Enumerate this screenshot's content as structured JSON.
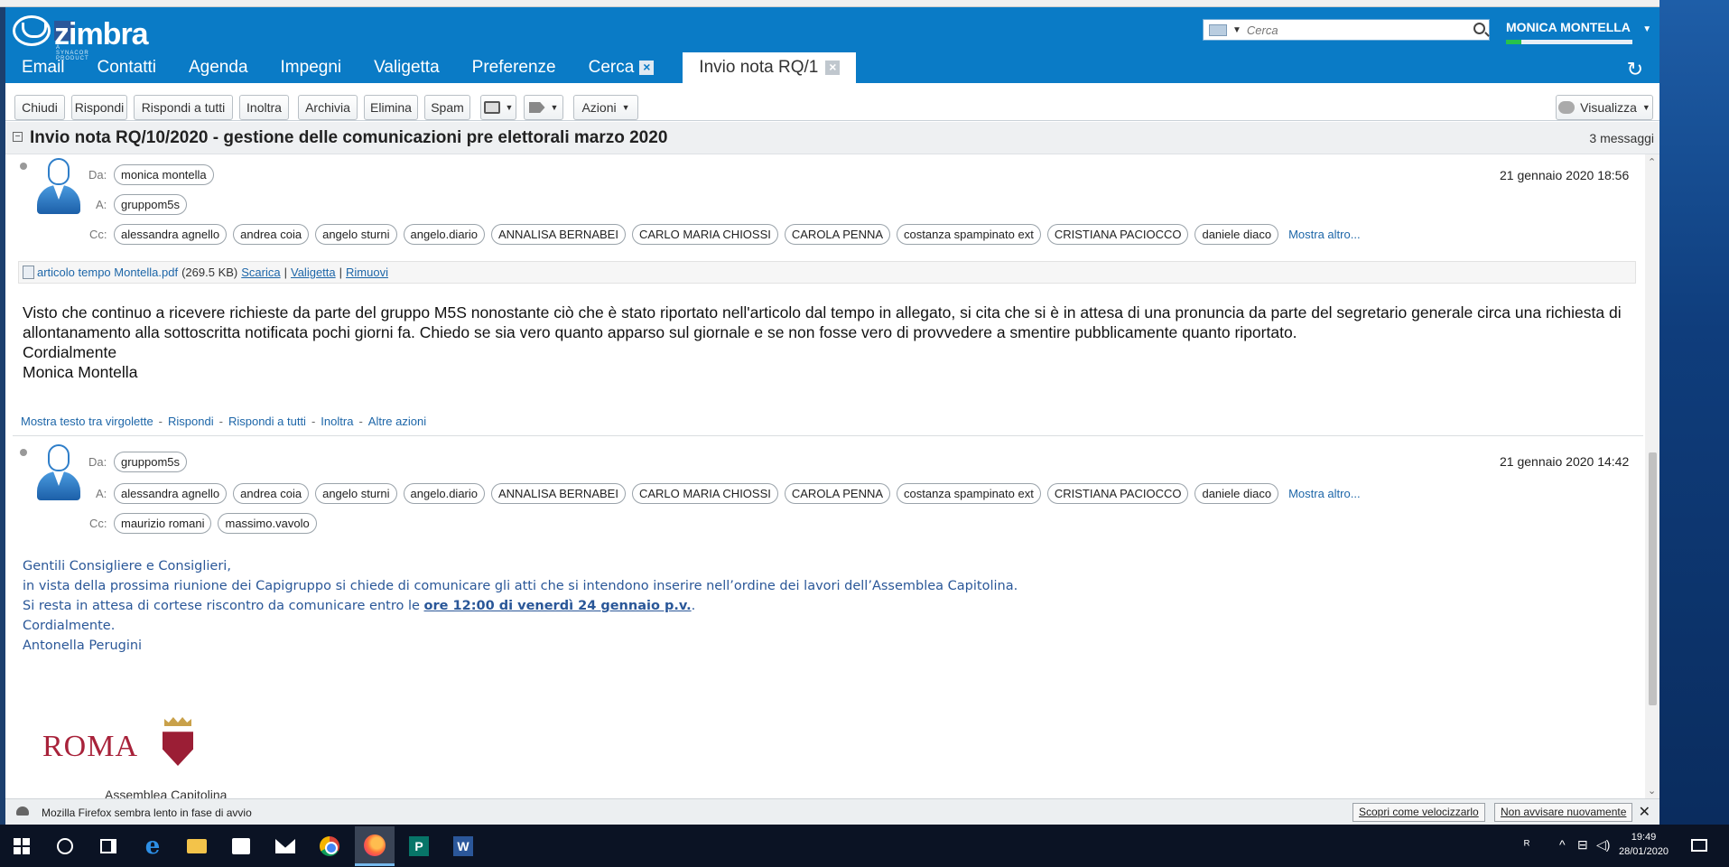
{
  "colors": {
    "brand": "#0a7bc6",
    "link": "#1d66a8",
    "body2_text": "#2a5798",
    "roma_red": "#a8223a"
  },
  "header": {
    "logo_text": "zimbra",
    "logo_sub": "A SYNACOR PRODUCT",
    "search_placeholder": "Cerca",
    "user_name": "MONICA MONTELLA",
    "quota_fraction": 0.12
  },
  "tabs": [
    {
      "label": "Email"
    },
    {
      "label": "Contatti"
    },
    {
      "label": "Agenda"
    },
    {
      "label": "Impegni"
    },
    {
      "label": "Valigetta"
    },
    {
      "label": "Preferenze"
    },
    {
      "label": "Cerca"
    },
    {
      "label": "Invio nota RQ/1"
    }
  ],
  "toolbar": {
    "close": "Chiudi",
    "reply": "Rispondi",
    "reply_all": "Rispondi a tutti",
    "forward": "Inoltra",
    "archive": "Archivia",
    "delete": "Elimina",
    "spam": "Spam",
    "actions": "Azioni",
    "view": "Visualizza"
  },
  "conversation": {
    "toggle": "−",
    "title": "Invio nota RQ/10/2020 - gestione delle comunicazioni pre elettorali marzo 2020",
    "count": "3 messaggi"
  },
  "labels": {
    "from": "Da:",
    "to": "A:",
    "cc": "Cc:"
  },
  "message1": {
    "from": "monica montella",
    "to": [
      "gruppom5s"
    ],
    "cc": [
      "alessandra agnello",
      "andrea coia",
      "angelo sturni",
      "angelo.diario",
      "ANNALISA BERNABEI",
      "CARLO MARIA CHIOSSI",
      "CAROLA PENNA",
      "costanza spampinato ext",
      "CRISTIANA PACIOCCO",
      "daniele diaco"
    ],
    "more": "Mostra altro...",
    "date": "21 gennaio 2020 18:56",
    "attachment": {
      "name": "articolo tempo Montella.pdf",
      "size": "(269.5 KB)",
      "download": "Scarica",
      "briefcase": "Valigetta",
      "remove": "Rimuovi"
    },
    "body": [
      "Visto che continuo a ricevere richieste da parte del gruppo M5S nonostante ciò che è stato riportato nell'articolo dal tempo in allegato,  si cita che si è in attesa di una pronuncia da parte del segretario generale circa una richiesta di allontanamento alla sottoscritta notificata pochi giorni fa. Chiedo se sia vero quanto apparso sul giornale e se non fosse vero di provvedere a smentire pubblicamente quanto riportato.",
      "Cordialmente",
      "Monica Montella"
    ],
    "actions": {
      "quoted": "Mostra testo tra virgolette",
      "reply": "Rispondi",
      "reply_all": "Rispondi a tutti",
      "forward": "Inoltra",
      "more": "Altre azioni"
    }
  },
  "message2": {
    "from": "gruppom5s",
    "to": [
      "alessandra agnello",
      "andrea coia",
      "angelo sturni",
      "angelo.diario",
      "ANNALISA BERNABEI",
      "CARLO MARIA CHIOSSI",
      "CAROLA PENNA",
      "costanza spampinato ext",
      "CRISTIANA PACIOCCO",
      "daniele diaco"
    ],
    "more": "Mostra altro...",
    "cc": [
      "maurizio romani",
      "massimo.vavolo"
    ],
    "date": "21 gennaio 2020 14:42",
    "body": {
      "line1": "Gentili Consigliere e Consiglieri,",
      "line2": "in vista della prossima riunione dei Capigruppo si chiede di comunicare gli atti che si intendono inserire nell’ordine dei lavori dell’Assemblea Capitolina.",
      "line3_pre": "Si resta in attesa di cortese riscontro da comunicare entro le ",
      "line3_bold": "ore 12:00 di venerdì 24 gennaio p.v.",
      "line3_post": ".",
      "line4": "Cordialmente.",
      "line5": "Antonella Perugini"
    },
    "signature_logo": "ROMA",
    "signature_org": "Assemblea Capitolina"
  },
  "notification": {
    "text": "Mozilla Firefox sembra lento in fase di avvio",
    "discover": "Scopri come velocizzarlo",
    "dont_warn": "Non avvisare nuovamente"
  },
  "taskbar": {
    "icons": [
      "windows-start-icon",
      "cortana-icon",
      "task-view-icon",
      "edge-icon",
      "file-explorer-icon",
      "store-icon",
      "mail-icon",
      "chrome-icon",
      "firefox-icon",
      "publisher-icon",
      "word-icon"
    ],
    "time": "19:49",
    "date": "28/01/2020"
  }
}
